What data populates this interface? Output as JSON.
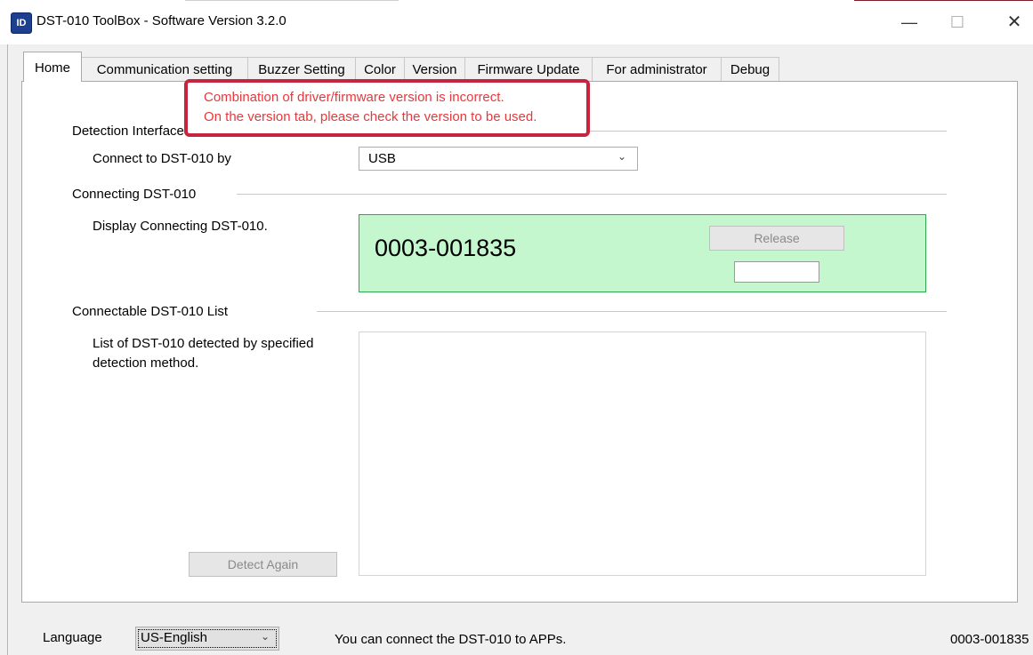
{
  "window": {
    "title": "DST-010 ToolBox - Software Version 3.2.0",
    "app_icon_text": "ID"
  },
  "window_controls": {
    "minimize": "—",
    "maximize": "☐",
    "close": "✕"
  },
  "tabs": [
    {
      "label": "Home",
      "active": true
    },
    {
      "label": "Communication setting",
      "active": false
    },
    {
      "label": "Buzzer Setting",
      "active": false
    },
    {
      "label": "Color",
      "active": false
    },
    {
      "label": "Version",
      "active": false
    },
    {
      "label": "Firmware Update",
      "active": false
    },
    {
      "label": "For administrator",
      "active": false
    },
    {
      "label": "Debug",
      "active": false
    }
  ],
  "error_tooltip": {
    "line1": "Combination of driver/firmware version is incorrect.",
    "line2": "On the version tab, please check the version to be used.",
    "color": "#e8383b",
    "border_color": "#c8243f"
  },
  "detection_interface": {
    "group_label": "Detection Interface",
    "connect_label": "Connect to DST-010 by",
    "connect_value": "USB"
  },
  "connecting": {
    "group_label": "Connecting DST-010",
    "description": "Display Connecting DST-010.",
    "device_id": "0003-001835",
    "release_label": "Release",
    "box_color": "#c5f7cf"
  },
  "connectable_list": {
    "group_label": "Connectable DST-010 List",
    "description_line1": "List of DST-010 detected by specified",
    "description_line2": "detection method.",
    "items": [],
    "detect_again_label": "Detect Again"
  },
  "status_bar": {
    "language_label": "Language",
    "language_value": "US-English",
    "message": "You can connect the DST-010 to APPs.",
    "device_id": "0003-001835"
  }
}
